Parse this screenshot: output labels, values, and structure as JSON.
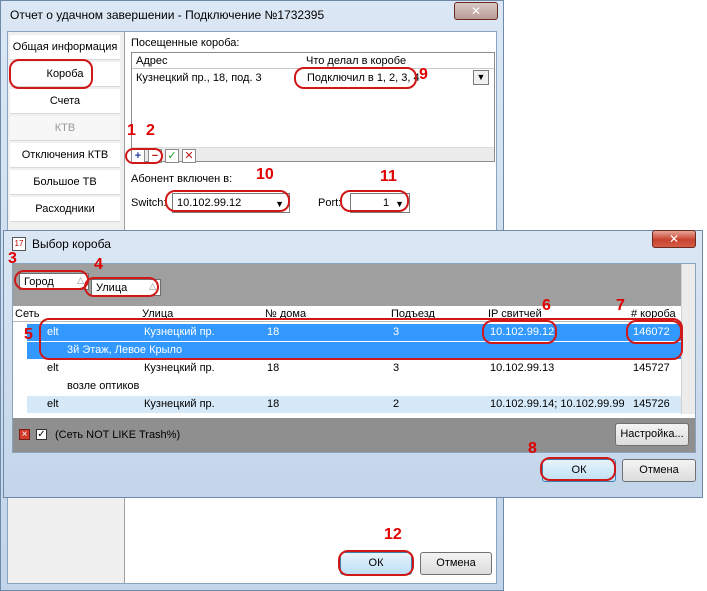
{
  "main_window": {
    "title": "Отчет о удачном завершении - Подключение №1732395",
    "close_label": "✕",
    "nav": [
      {
        "label": "Общая информация"
      },
      {
        "label": "Короба"
      },
      {
        "label": "Счета"
      },
      {
        "label": "КТВ"
      },
      {
        "label": "Отключения КТВ"
      },
      {
        "label": "Большое ТВ"
      },
      {
        "label": "Расходники"
      }
    ],
    "visited_label": "Посещенные короба:",
    "grid": {
      "col_address": "Адрес",
      "col_action": "Что делал в коробе",
      "row_address": "Кузнецкий пр., 18, под. 3",
      "row_action": "Подключил в 1, 2, 3, 4"
    },
    "subscriber_label": "Абонент включен в:",
    "switch_label": "Switch:",
    "switch_value": "10.102.99.12",
    "port_label": "Port:",
    "port_value": "1",
    "ok_label": "ОК",
    "cancel_label": "Отмена"
  },
  "dialog": {
    "title": "Выбор короба",
    "close_label": "✕",
    "group_city": "Город",
    "group_street": "Улица",
    "columns": [
      "Сеть",
      "Улица",
      "№ дома",
      "Подъезд",
      "IP свитчей",
      "# короба"
    ],
    "rows": [
      {
        "net": "elt",
        "street": "Кузнецкий пр.",
        "house": "18",
        "entrance": "3",
        "ip": "10.102.99.12",
        "box": "146072",
        "note": "3й Этаж, Левое Крыло"
      },
      {
        "net": "elt",
        "street": "Кузнецкий пр.",
        "house": "18",
        "entrance": "3",
        "ip": "10.102.99.13",
        "box": "145727",
        "note": "возле оптиков"
      },
      {
        "net": "elt",
        "street": "Кузнецкий пр.",
        "house": "18",
        "entrance": "2",
        "ip": "10.102.99.14; 10.102.99.99",
        "box": "145726"
      }
    ],
    "filter_text": "(Сеть NOT LIKE Trash%)",
    "settings_label": "Настройка...",
    "ok_label": "ОК",
    "cancel_label": "Отмена"
  },
  "annotations": {
    "n1": "1",
    "n2": "2",
    "n3": "3",
    "n4": "4",
    "n5": "5",
    "n6": "6",
    "n7": "7",
    "n8": "8",
    "n9": "9",
    "n10": "10",
    "n11": "11",
    "n12": "12"
  },
  "colors": {
    "selection": "#3399ff",
    "annotation": "#d01818"
  }
}
